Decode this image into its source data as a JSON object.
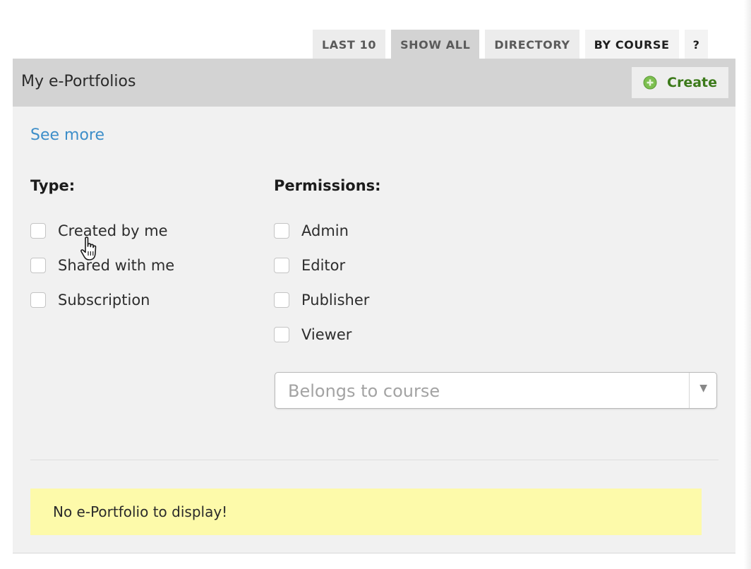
{
  "tabs": [
    {
      "label": "LAST 10"
    },
    {
      "label": "SHOW ALL"
    },
    {
      "label": "DIRECTORY"
    },
    {
      "label": "BY COURSE"
    },
    {
      "label": "?"
    }
  ],
  "panel": {
    "title": "My e-Portfolios",
    "create_label": "Create",
    "see_more": "See more"
  },
  "filters": {
    "type": {
      "title": "Type:",
      "options": [
        {
          "label": "Created by me",
          "checked": false
        },
        {
          "label": "Shared with me",
          "checked": false
        },
        {
          "label": "Subscription",
          "checked": false
        }
      ]
    },
    "permissions": {
      "title": "Permissions:",
      "options": [
        {
          "label": "Admin",
          "checked": false
        },
        {
          "label": "Editor",
          "checked": false
        },
        {
          "label": "Publisher",
          "checked": false
        },
        {
          "label": "Viewer",
          "checked": false
        }
      ]
    },
    "course_select": {
      "placeholder": "Belongs to course"
    }
  },
  "empty_message": "No e-Portfolio to display!",
  "colors": {
    "accent_link": "#3d8ec9",
    "create_green": "#3c7a1a",
    "notice_yellow": "#fdfaaa",
    "header_gray": "#d3d3d3",
    "panel_bg": "#f1f1f1"
  }
}
